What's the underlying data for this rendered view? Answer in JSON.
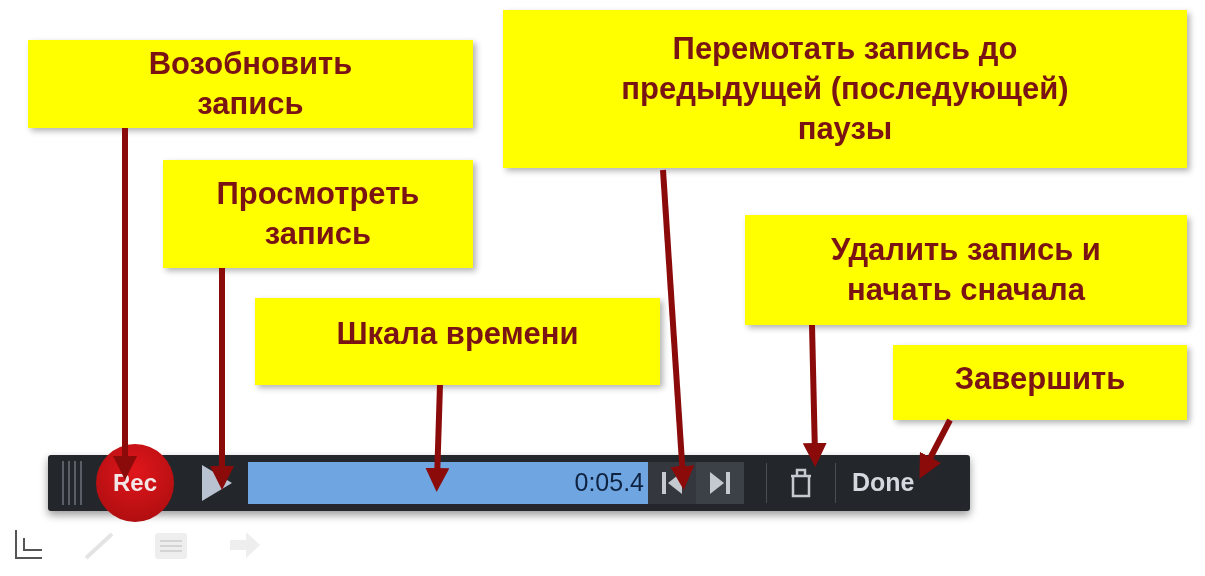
{
  "callouts": [
    {
      "text": "Возобновить\nзапись"
    },
    {
      "text": "Просмотреть\nзапись"
    },
    {
      "text": "Шкала времени"
    },
    {
      "text": "Перемотать запись до\nпредыдущей (последующей)\nпаузы"
    },
    {
      "text": "Удалить запись и\nначать сначала"
    },
    {
      "text": "Завершить"
    }
  ],
  "toolbar": {
    "record_button": "Rec",
    "time": "0:05.4",
    "done_button": "Done"
  }
}
